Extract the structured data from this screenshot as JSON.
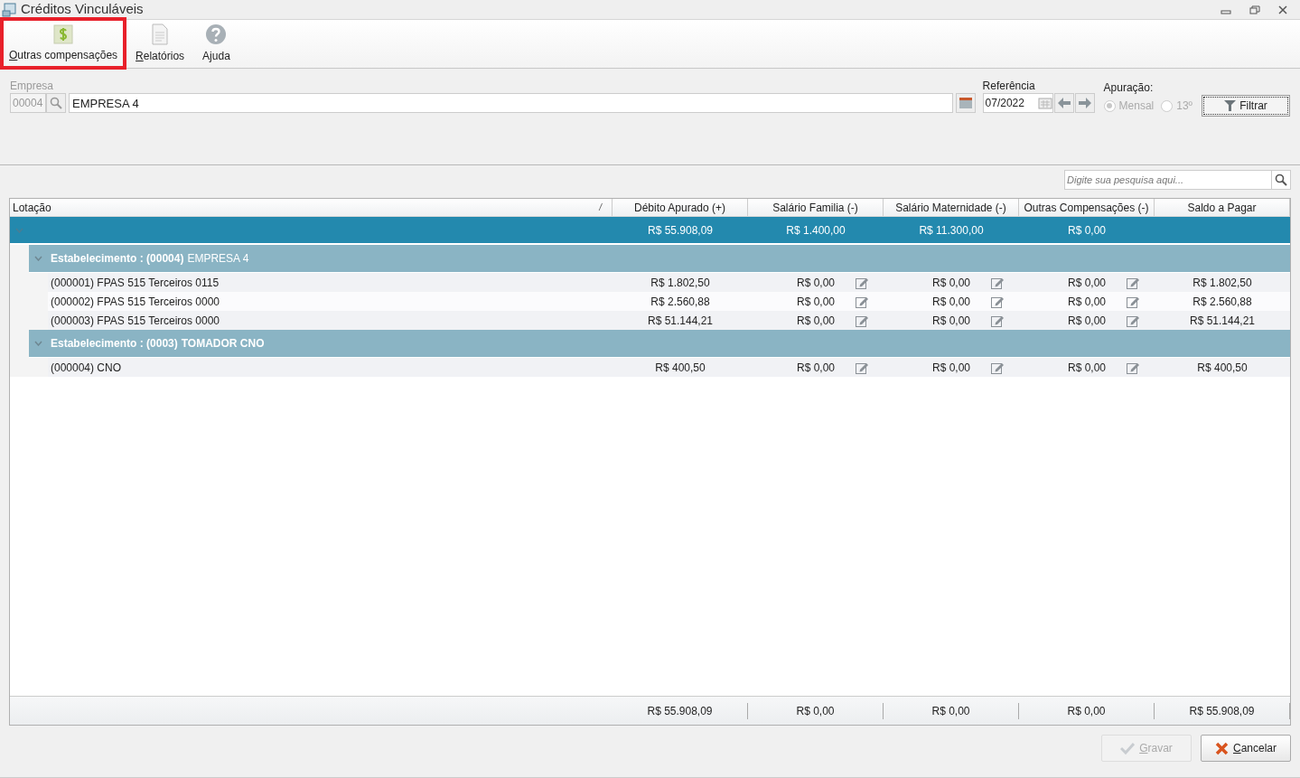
{
  "window": {
    "title": "Créditos Vinculáveis"
  },
  "toolbar": [
    {
      "kind": "money",
      "label": "Outras compensações",
      "mnemonic": true,
      "highlighted": true
    },
    {
      "kind": "report",
      "label": "Relatórios",
      "mnemonic": true,
      "highlighted": false
    },
    {
      "kind": "help",
      "label": "Ajuda",
      "mnemonic": false,
      "highlighted": false
    }
  ],
  "filters": {
    "empresa_label": "Empresa",
    "empresa_code": "00004",
    "empresa_name": "EMPRESA 4",
    "referencia_label": "Referência",
    "referencia_value": "07/2022",
    "apuracao_label": "Apuração:",
    "apuracao_options": [
      {
        "label": "Mensal",
        "selected": true
      },
      {
        "label": "13º",
        "selected": false
      }
    ],
    "filter_button": "Filtrar"
  },
  "search": {
    "placeholder": "Digite sua pesquisa aqui..."
  },
  "grid": {
    "columns": [
      "Lotação",
      "Débito Apurado (+)",
      "Salário Familia (-)",
      "Salário Maternidade (-)",
      "Outras Compensações (-)",
      "Saldo a Pagar"
    ],
    "sort_mark": "/",
    "total_row": {
      "expanded": true,
      "values": [
        "R$ 55.908,09",
        "R$ 1.400,00",
        "R$ 11.300,00",
        "R$ 0,00"
      ]
    },
    "groups": [
      {
        "expanded": true,
        "title": "Estabelecimento : (00004)",
        "name": "EMPRESA 4",
        "name_bold": false,
        "rows": [
          {
            "lotacao": "(000001) FPAS 515 Terceiros 0115",
            "values": [
              "R$ 1.802,50",
              "R$ 0,00",
              "R$ 0,00",
              "R$ 0,00",
              "R$ 1.802,50"
            ]
          },
          {
            "lotacao": "(000002) FPAS 515 Terceiros 0000",
            "values": [
              "R$ 2.560,88",
              "R$ 0,00",
              "R$ 0,00",
              "R$ 0,00",
              "R$ 2.560,88"
            ]
          },
          {
            "lotacao": "(000003) FPAS 515 Terceiros 0000",
            "values": [
              "R$ 51.144,21",
              "R$ 0,00",
              "R$ 0,00",
              "R$ 0,00",
              "R$ 51.144,21"
            ]
          }
        ]
      },
      {
        "expanded": true,
        "title": "Estabelecimento : (0003)",
        "name": "TOMADOR CNO",
        "name_bold": true,
        "rows": [
          {
            "lotacao": "(000004) CNO",
            "values": [
              "R$ 400,50",
              "R$ 0,00",
              "R$ 0,00",
              "R$ 0,00",
              "R$ 400,50"
            ]
          }
        ]
      }
    ],
    "footer": [
      "R$ 55.908,09",
      "R$ 0,00",
      "R$ 0,00",
      "R$ 0,00",
      "R$ 55.908,09"
    ]
  },
  "buttons": [
    {
      "kind": "save",
      "label": "Gravar",
      "disabled": true
    },
    {
      "kind": "cancel",
      "label": "Cancelar",
      "disabled": false
    }
  ]
}
